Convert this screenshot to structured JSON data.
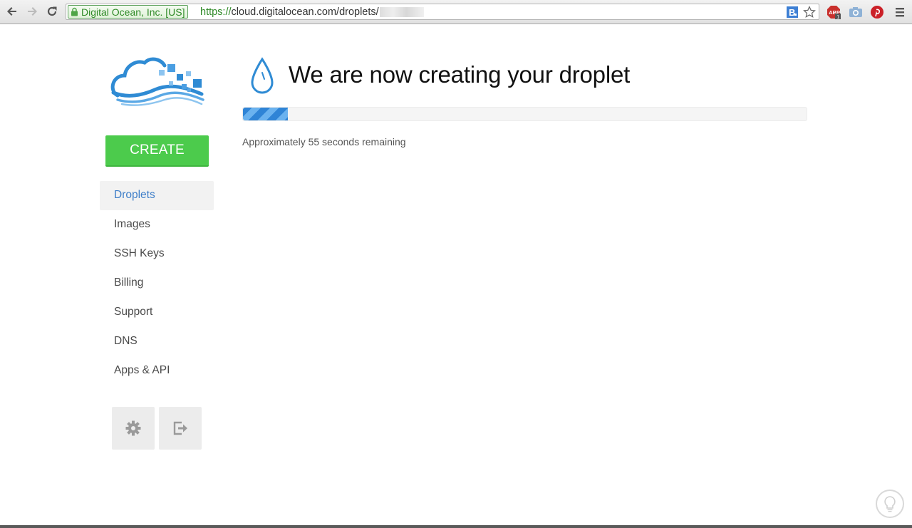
{
  "browser": {
    "ev_label": "Digital Ocean, Inc. [US]",
    "url_scheme": "https://",
    "url_rest": "cloud.digitalocean.com/droplets/",
    "ext_abp_count": "1"
  },
  "sidebar": {
    "create_label": "CREATE",
    "items": [
      {
        "label": "Droplets",
        "active": true
      },
      {
        "label": "Images"
      },
      {
        "label": "SSH Keys"
      },
      {
        "label": "Billing"
      },
      {
        "label": "Support"
      },
      {
        "label": "DNS"
      },
      {
        "label": "Apps & API"
      }
    ]
  },
  "main": {
    "title": "We are now creating your droplet",
    "progress_fraction": 0.08,
    "remaining_text": "Approximately 55 seconds remaining"
  },
  "colors": {
    "accent_blue": "#3f7fc9",
    "create_green": "#4ccb4c"
  }
}
